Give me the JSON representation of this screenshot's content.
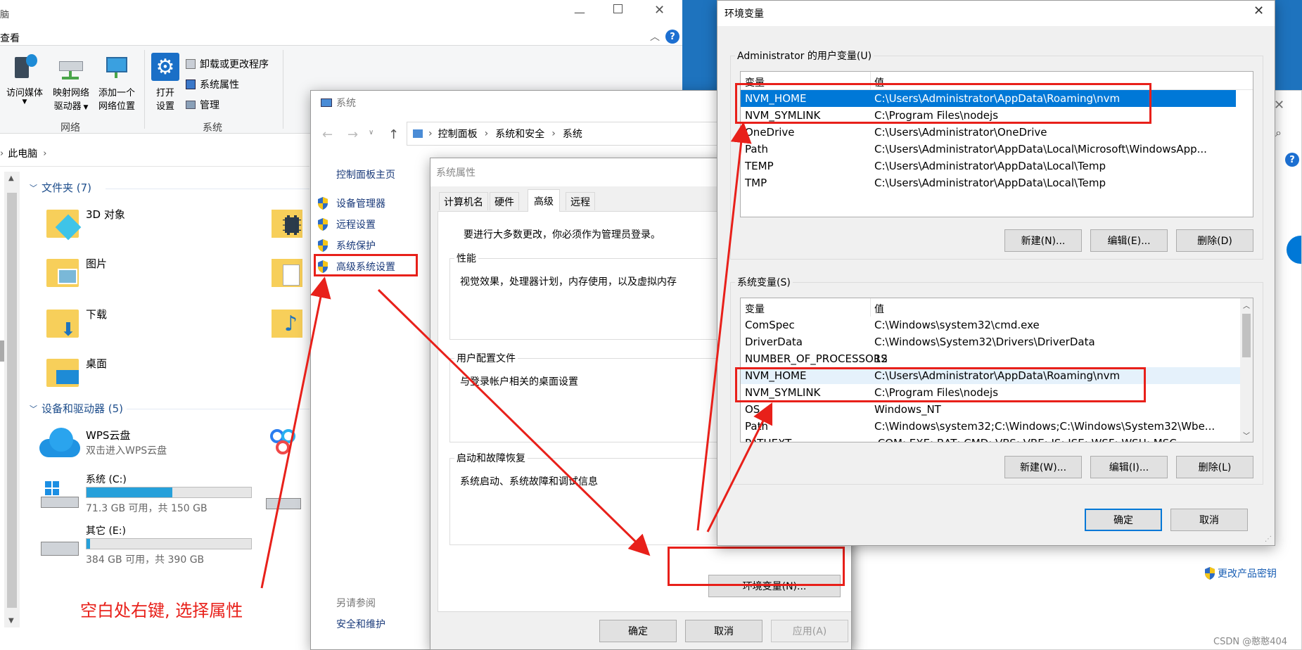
{
  "explorer": {
    "title_partial": "脑",
    "tab_view": "查看",
    "ribbon": {
      "access_media": "访问媒体",
      "map_drive_l1": "映射网络",
      "map_drive_l2": "驱动器",
      "add_location_l1": "添加一个",
      "add_location_l2": "网络位置",
      "open_settings_l1": "打开",
      "open_settings_l2": "设置",
      "uninstall": "卸载或更改程序",
      "sys_props": "系统属性",
      "manage": "管理",
      "group_network": "网络",
      "group_system": "系统"
    },
    "path_this_pc": "此电脑",
    "folders_header": "文件夹 (7)",
    "folders": [
      "3D 对象",
      "图片",
      "下载",
      "桌面"
    ],
    "devices_header": "设备和驱动器 (5)",
    "wps_name": "WPS云盘",
    "wps_sub": "双击进入WPS云盘",
    "drive_c_name": "系统 (C:)",
    "drive_c_info": "71.3 GB 可用，共 150 GB",
    "drive_c_used_fraction": 0.52,
    "drive_e_name": "其它 (E:)",
    "drive_e_info": "384 GB 可用，共 390 GB",
    "drive_e_used_fraction": 0.02
  },
  "annotation": "空白处右键, 选择属性",
  "system_window": {
    "title": "系统",
    "breadcrumb": [
      "控制面板",
      "系统和安全",
      "系统"
    ],
    "home": "控制面板主页",
    "links": [
      "设备管理器",
      "远程设置",
      "系统保护",
      "高级系统设置"
    ],
    "see_also": "另请参阅",
    "security": "安全和维护"
  },
  "sys_props": {
    "title": "系统属性",
    "tabs": [
      "计算机名",
      "硬件",
      "高级",
      "远程"
    ],
    "admin_note": "要进行大多数更改，你必须作为管理员登录。",
    "perf_label": "性能",
    "perf_desc": "视觉效果，处理器计划，内存使用，以及虚拟内存",
    "profile_label": "用户配置文件",
    "profile_desc": "与登录帐户相关的桌面设置",
    "startup_label": "启动和故障恢复",
    "startup_desc": "系统启动、系统故障和调试信息",
    "env_button": "环境变量(N)...",
    "ok": "确定",
    "cancel": "取消",
    "apply": "应用(A)"
  },
  "env_window": {
    "title": "环境变量",
    "user_label": "Administrator 的用户变量(U)",
    "col_var": "变量",
    "col_val": "值",
    "user_vars": [
      {
        "name": "NVM_HOME",
        "value": "C:\\Users\\Administrator\\AppData\\Roaming\\nvm"
      },
      {
        "name": "NVM_SYMLINK",
        "value": "C:\\Program Files\\nodejs"
      },
      {
        "name": "OneDrive",
        "value": "C:\\Users\\Administrator\\OneDrive"
      },
      {
        "name": "Path",
        "value": "C:\\Users\\Administrator\\AppData\\Local\\Microsoft\\WindowsApp..."
      },
      {
        "name": "TEMP",
        "value": "C:\\Users\\Administrator\\AppData\\Local\\Temp"
      },
      {
        "name": "TMP",
        "value": "C:\\Users\\Administrator\\AppData\\Local\\Temp"
      }
    ],
    "user_new": "新建(N)...",
    "user_edit": "编辑(E)...",
    "user_delete": "删除(D)",
    "sys_label": "系统变量(S)",
    "sys_vars": [
      {
        "name": "ComSpec",
        "value": "C:\\Windows\\system32\\cmd.exe"
      },
      {
        "name": "DriverData",
        "value": "C:\\Windows\\System32\\Drivers\\DriverData"
      },
      {
        "name": "NUMBER_OF_PROCESSORS",
        "value": "12"
      },
      {
        "name": "NVM_HOME",
        "value": "C:\\Users\\Administrator\\AppData\\Roaming\\nvm"
      },
      {
        "name": "NVM_SYMLINK",
        "value": "C:\\Program Files\\nodejs"
      },
      {
        "name": "OS",
        "value": "Windows_NT"
      },
      {
        "name": "Path",
        "value": "C:\\Windows\\system32;C:\\Windows;C:\\Windows\\System32\\Wbe..."
      },
      {
        "name": "PATHEXT",
        "value": ".COM;.EXE;.BAT;.CMD;.VBS;.VBE;.JS;.JSE;.WSF;.WSH;.MSC"
      }
    ],
    "sys_new": "新建(W)...",
    "sys_edit": "编辑(I)...",
    "sys_delete": "删除(L)",
    "ok": "确定",
    "cancel": "取消"
  },
  "right_bg": {
    "change_key": "更改产品密钥"
  },
  "watermark": "CSDN @憨憨404",
  "colors": {
    "accent": "#0078d7",
    "red": "#e8201a",
    "desktop": "#1e73be"
  }
}
